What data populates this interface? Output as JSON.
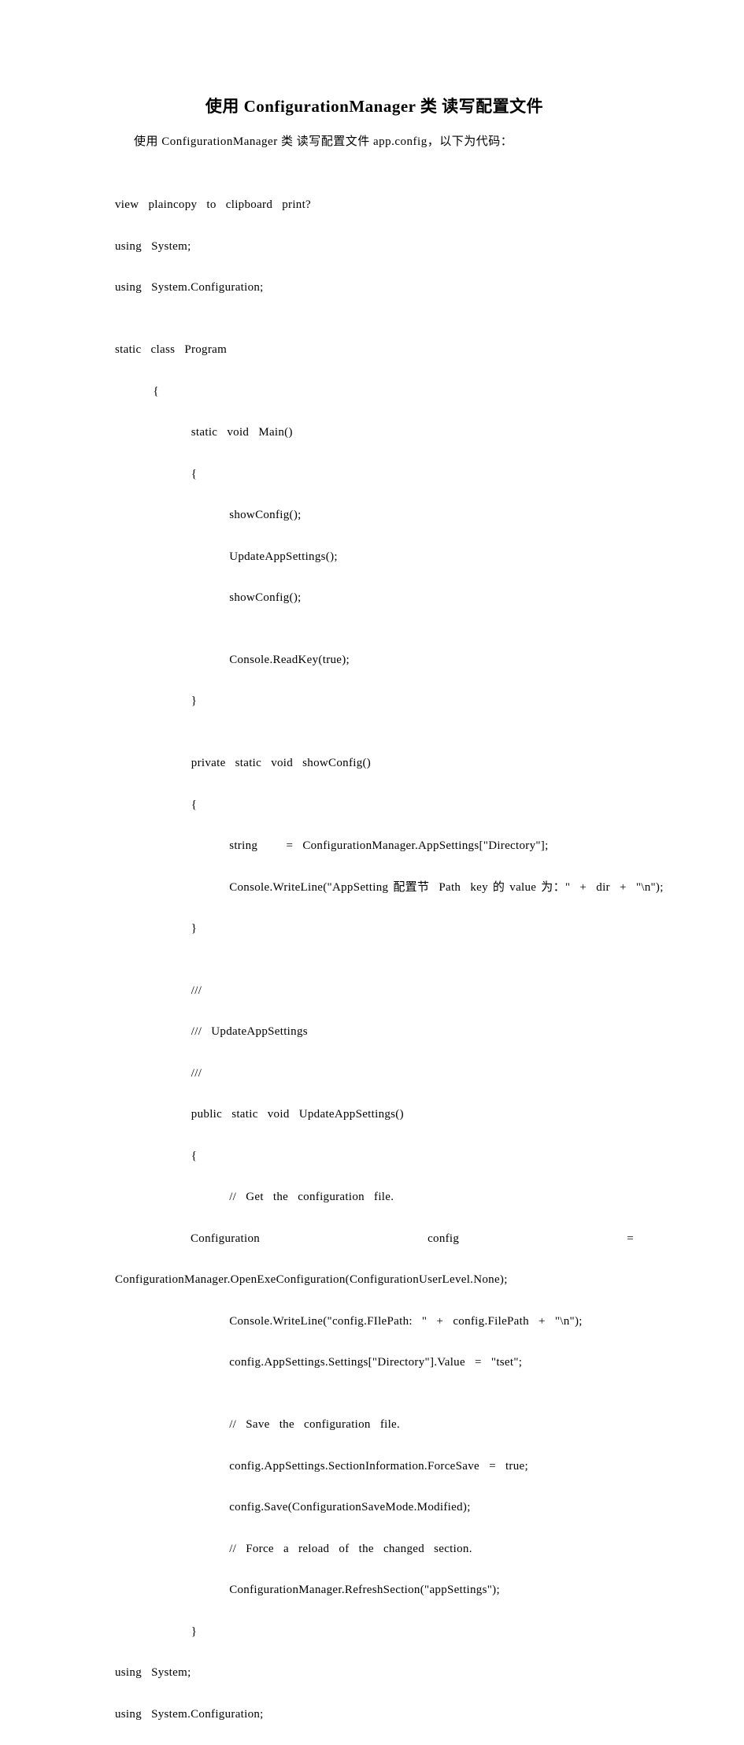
{
  "title": "使用 ConfigurationManager 类  读写配置文件",
  "intro": "使用 ConfigurationManager 类  读写配置文件 app.config，以下为代码：",
  "lines": {
    "l1": "view  plaincopy  to  clipboard  print?",
    "l2": "using  System;",
    "l3": "using  System.Configuration;",
    "l4": "",
    "l5": "static  class  Program",
    "l6": "        {",
    "l7": "                static  void  Main()",
    "l8": "                {",
    "l9": "                        showConfig();",
    "l10": "                        UpdateAppSettings();",
    "l11": "                        showConfig();",
    "l12": "",
    "l13": "                        Console.ReadKey(true);",
    "l14": "                }",
    "l15": "",
    "l16": "                private  static  void  showConfig()",
    "l17": "                {",
    "l18": "                        string      =  ConfigurationManager.AppSettings[\"Directory\"];",
    "l19": "                        Console.WriteLine(\"AppSetting 配置节  Path  key 的 value 为：\"  +  dir  +  \"\\n\");",
    "l20": "                }",
    "l21": "",
    "l22": "                ///",
    "l23": "                ///  UpdateAppSettings",
    "l24": "                ///",
    "l25": "                public  static  void  UpdateAppSettings()",
    "l26": "                {",
    "l27": "                        //  Get  the  configuration  file.",
    "j1a": "Configuration",
    "j1b": "config",
    "j1c": "=",
    "l29": "ConfigurationManager.OpenExeConfiguration(ConfigurationUserLevel.None);",
    "l30": "                        Console.WriteLine(\"config.FIlePath:  \"  +  config.FilePath  +  \"\\n\");",
    "l31": "                        config.AppSettings.Settings[\"Directory\"].Value  =  \"tset\";",
    "l32": "",
    "l33": "                        //  Save  the  configuration  file.",
    "l34": "                        config.AppSettings.SectionInformation.ForceSave  =  true;",
    "l35": "                        config.Save(ConfigurationSaveMode.Modified);",
    "l36": "                        //  Force  a  reload  of  the  changed  section.",
    "l37": "                        ConfigurationManager.RefreshSection(\"appSettings\");",
    "l38": "                }",
    "l39": "using  System;",
    "l40": "using  System.Configuration;"
  }
}
